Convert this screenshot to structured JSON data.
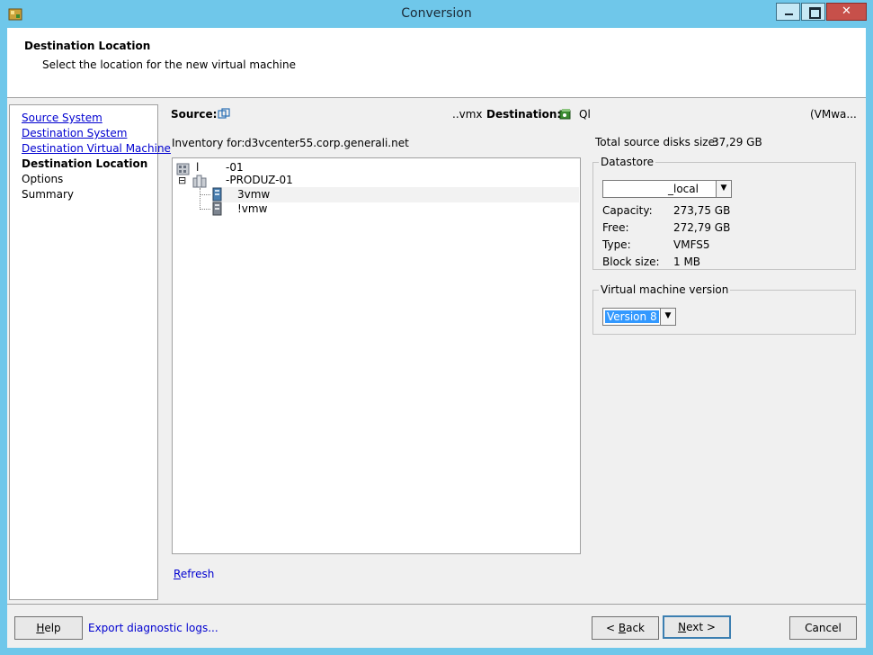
{
  "window": {
    "title": "Conversion",
    "minimize_glyph": "_",
    "maximize_glyph": "□",
    "close_glyph": "✕",
    "app_icon": "converter-app-icon"
  },
  "header": {
    "title": "Destination Location",
    "subtitle": "Select the location for the new virtual machine"
  },
  "nav": {
    "items": [
      {
        "label": "Source System",
        "state": "link"
      },
      {
        "label": "Destination System",
        "state": "link"
      },
      {
        "label": "Destination Virtual Machine",
        "state": "link"
      },
      {
        "label": "Destination Location",
        "state": "current"
      },
      {
        "label": "Options",
        "state": "plain"
      },
      {
        "label": "Summary",
        "state": "plain"
      }
    ]
  },
  "info_bar": {
    "source_label": "Source:",
    "source_value": "..vmx",
    "destination_label": "Destination:",
    "destination_value": "Ql",
    "destination_type": "(VMwa..."
  },
  "inventory": {
    "label": "Inventory for:",
    "server": "d3vcenter55.corp.generali.net",
    "tree": [
      {
        "text": "l",
        "suffix": "-01",
        "icon": "datacenter-icon",
        "level": 0
      },
      {
        "text": "-PRODUZ-01",
        "icon": "cluster-icon",
        "level": 1,
        "expanded": true
      },
      {
        "text": "3vmw",
        "icon": "host-icon",
        "level": 2,
        "selected": true
      },
      {
        "text": "!vmw",
        "icon": "host-icon",
        "level": 2
      }
    ],
    "refresh_label": "Refresh",
    "expand_glyph": "⊟"
  },
  "disks": {
    "label": "Total source disks size:",
    "value": "37,29 GB"
  },
  "datastore": {
    "legend": "Datastore",
    "selected": "_local",
    "capacity_label": "Capacity:",
    "capacity_value": "273,75 GB",
    "free_label": "Free:",
    "free_value": "272,79 GB",
    "type_label": "Type:",
    "type_value": "VMFS5",
    "block_label": "Block size:",
    "block_value": "1 MB"
  },
  "vm_version": {
    "legend": "Virtual machine version",
    "selected": "Version 8"
  },
  "footer": {
    "help": "Help",
    "export": "Export diagnostic logs...",
    "back": "< Back",
    "next": "Next >",
    "cancel": "Cancel"
  },
  "colors": {
    "titlebar": "#6fc7ea",
    "link": "#0000d0",
    "selection": "#3399ff"
  }
}
